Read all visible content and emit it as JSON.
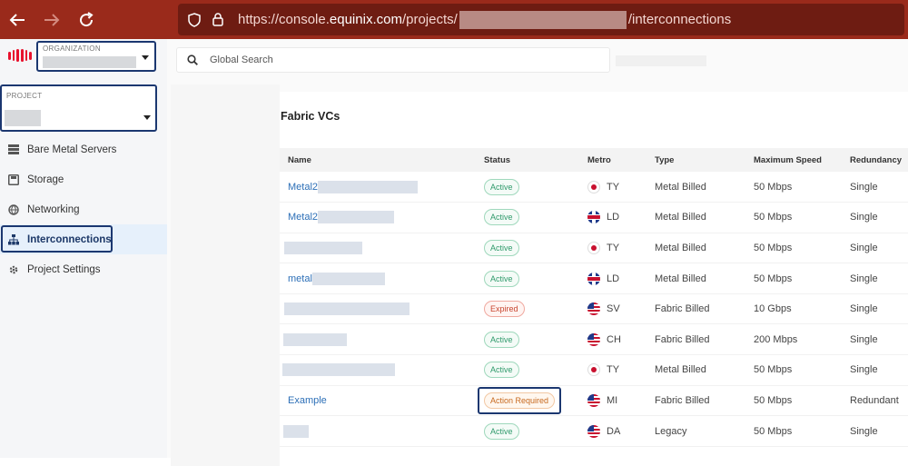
{
  "browser": {
    "url_prefix": "https://console.",
    "url_host": "equinix.com",
    "url_path_start": "/projects/",
    "url_path_end": "/interconnections"
  },
  "sidebar": {
    "org_label": "ORGANIZATION",
    "project_label": "PROJECT",
    "items": [
      {
        "label": "Bare Metal Servers",
        "icon": "server-icon"
      },
      {
        "label": "Storage",
        "icon": "storage-icon"
      },
      {
        "label": "Networking",
        "icon": "globe-icon"
      },
      {
        "label": "Interconnections",
        "icon": "hierarchy-icon",
        "active": true
      },
      {
        "label": "Project Settings",
        "icon": "gear-icon"
      }
    ]
  },
  "search": {
    "placeholder": "Global Search"
  },
  "page": {
    "title": "Fabric VCs"
  },
  "table": {
    "columns": [
      "Name",
      "Status",
      "Metro",
      "Type",
      "Maximum Speed",
      "Redundancy"
    ],
    "rows": [
      {
        "name": "Metal2",
        "status": "Active",
        "metro": "TY",
        "flag": "jp",
        "type": "Metal Billed",
        "speed": "50 Mbps",
        "redundancy": "Single"
      },
      {
        "name": "Metal2",
        "status": "Active",
        "metro": "LD",
        "flag": "uk",
        "type": "Metal Billed",
        "speed": "50 Mbps",
        "redundancy": "Single"
      },
      {
        "name": "",
        "status": "Active",
        "metro": "TY",
        "flag": "jp",
        "type": "Metal Billed",
        "speed": "50 Mbps",
        "redundancy": "Single"
      },
      {
        "name": "metal",
        "status": "Active",
        "metro": "LD",
        "flag": "uk",
        "type": "Metal Billed",
        "speed": "50 Mbps",
        "redundancy": "Single"
      },
      {
        "name": "",
        "status": "Expired",
        "metro": "SV",
        "flag": "us",
        "type": "Fabric Billed",
        "speed": "10 Gbps",
        "redundancy": "Single"
      },
      {
        "name": "",
        "status": "Active",
        "metro": "CH",
        "flag": "us",
        "type": "Fabric Billed",
        "speed": "200 Mbps",
        "redundancy": "Single"
      },
      {
        "name": "",
        "status": "Active",
        "metro": "TY",
        "flag": "jp",
        "type": "Metal Billed",
        "speed": "50 Mbps",
        "redundancy": "Single"
      },
      {
        "name": "Example",
        "status": "Action Required",
        "metro": "MI",
        "flag": "us",
        "type": "Fabric Billed",
        "speed": "50 Mbps",
        "redundancy": "Redundant"
      },
      {
        "name": "",
        "status": "Active",
        "metro": "DA",
        "flag": "us",
        "type": "Legacy",
        "speed": "50 Mbps",
        "redundancy": "Single"
      }
    ]
  }
}
